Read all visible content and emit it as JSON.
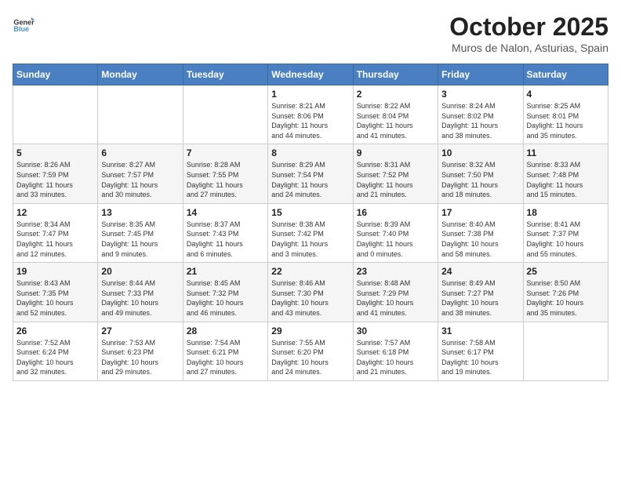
{
  "logo": {
    "general": "General",
    "blue": "Blue"
  },
  "title": "October 2025",
  "subtitle": "Muros de Nalon, Asturias, Spain",
  "weekdays": [
    "Sunday",
    "Monday",
    "Tuesday",
    "Wednesday",
    "Thursday",
    "Friday",
    "Saturday"
  ],
  "weeks": [
    [
      {
        "day": "",
        "info": ""
      },
      {
        "day": "",
        "info": ""
      },
      {
        "day": "",
        "info": ""
      },
      {
        "day": "1",
        "info": "Sunrise: 8:21 AM\nSunset: 8:06 PM\nDaylight: 11 hours\nand 44 minutes."
      },
      {
        "day": "2",
        "info": "Sunrise: 8:22 AM\nSunset: 8:04 PM\nDaylight: 11 hours\nand 41 minutes."
      },
      {
        "day": "3",
        "info": "Sunrise: 8:24 AM\nSunset: 8:02 PM\nDaylight: 11 hours\nand 38 minutes."
      },
      {
        "day": "4",
        "info": "Sunrise: 8:25 AM\nSunset: 8:01 PM\nDaylight: 11 hours\nand 35 minutes."
      }
    ],
    [
      {
        "day": "5",
        "info": "Sunrise: 8:26 AM\nSunset: 7:59 PM\nDaylight: 11 hours\nand 33 minutes."
      },
      {
        "day": "6",
        "info": "Sunrise: 8:27 AM\nSunset: 7:57 PM\nDaylight: 11 hours\nand 30 minutes."
      },
      {
        "day": "7",
        "info": "Sunrise: 8:28 AM\nSunset: 7:55 PM\nDaylight: 11 hours\nand 27 minutes."
      },
      {
        "day": "8",
        "info": "Sunrise: 8:29 AM\nSunset: 7:54 PM\nDaylight: 11 hours\nand 24 minutes."
      },
      {
        "day": "9",
        "info": "Sunrise: 8:31 AM\nSunset: 7:52 PM\nDaylight: 11 hours\nand 21 minutes."
      },
      {
        "day": "10",
        "info": "Sunrise: 8:32 AM\nSunset: 7:50 PM\nDaylight: 11 hours\nand 18 minutes."
      },
      {
        "day": "11",
        "info": "Sunrise: 8:33 AM\nSunset: 7:48 PM\nDaylight: 11 hours\nand 15 minutes."
      }
    ],
    [
      {
        "day": "12",
        "info": "Sunrise: 8:34 AM\nSunset: 7:47 PM\nDaylight: 11 hours\nand 12 minutes."
      },
      {
        "day": "13",
        "info": "Sunrise: 8:35 AM\nSunset: 7:45 PM\nDaylight: 11 hours\nand 9 minutes."
      },
      {
        "day": "14",
        "info": "Sunrise: 8:37 AM\nSunset: 7:43 PM\nDaylight: 11 hours\nand 6 minutes."
      },
      {
        "day": "15",
        "info": "Sunrise: 8:38 AM\nSunset: 7:42 PM\nDaylight: 11 hours\nand 3 minutes."
      },
      {
        "day": "16",
        "info": "Sunrise: 8:39 AM\nSunset: 7:40 PM\nDaylight: 11 hours\nand 0 minutes."
      },
      {
        "day": "17",
        "info": "Sunrise: 8:40 AM\nSunset: 7:38 PM\nDaylight: 10 hours\nand 58 minutes."
      },
      {
        "day": "18",
        "info": "Sunrise: 8:41 AM\nSunset: 7:37 PM\nDaylight: 10 hours\nand 55 minutes."
      }
    ],
    [
      {
        "day": "19",
        "info": "Sunrise: 8:43 AM\nSunset: 7:35 PM\nDaylight: 10 hours\nand 52 minutes."
      },
      {
        "day": "20",
        "info": "Sunrise: 8:44 AM\nSunset: 7:33 PM\nDaylight: 10 hours\nand 49 minutes."
      },
      {
        "day": "21",
        "info": "Sunrise: 8:45 AM\nSunset: 7:32 PM\nDaylight: 10 hours\nand 46 minutes."
      },
      {
        "day": "22",
        "info": "Sunrise: 8:46 AM\nSunset: 7:30 PM\nDaylight: 10 hours\nand 43 minutes."
      },
      {
        "day": "23",
        "info": "Sunrise: 8:48 AM\nSunset: 7:29 PM\nDaylight: 10 hours\nand 41 minutes."
      },
      {
        "day": "24",
        "info": "Sunrise: 8:49 AM\nSunset: 7:27 PM\nDaylight: 10 hours\nand 38 minutes."
      },
      {
        "day": "25",
        "info": "Sunrise: 8:50 AM\nSunset: 7:26 PM\nDaylight: 10 hours\nand 35 minutes."
      }
    ],
    [
      {
        "day": "26",
        "info": "Sunrise: 7:52 AM\nSunset: 6:24 PM\nDaylight: 10 hours\nand 32 minutes."
      },
      {
        "day": "27",
        "info": "Sunrise: 7:53 AM\nSunset: 6:23 PM\nDaylight: 10 hours\nand 29 minutes."
      },
      {
        "day": "28",
        "info": "Sunrise: 7:54 AM\nSunset: 6:21 PM\nDaylight: 10 hours\nand 27 minutes."
      },
      {
        "day": "29",
        "info": "Sunrise: 7:55 AM\nSunset: 6:20 PM\nDaylight: 10 hours\nand 24 minutes."
      },
      {
        "day": "30",
        "info": "Sunrise: 7:57 AM\nSunset: 6:18 PM\nDaylight: 10 hours\nand 21 minutes."
      },
      {
        "day": "31",
        "info": "Sunrise: 7:58 AM\nSunset: 6:17 PM\nDaylight: 10 hours\nand 19 minutes."
      },
      {
        "day": "",
        "info": ""
      }
    ]
  ]
}
